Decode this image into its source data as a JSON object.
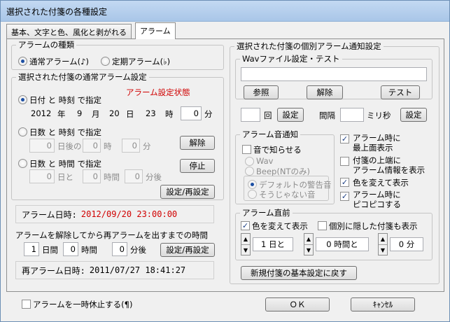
{
  "window": {
    "title": "選択された付箋の各種設定"
  },
  "tabs": [
    {
      "label": "基本、文字と色、風化と剥がれる"
    },
    {
      "label": "アラーム"
    }
  ],
  "alarm_kind": {
    "legend": "アラームの種類",
    "options": [
      {
        "label": "通常アラーム(♪)",
        "selected": true
      },
      {
        "label": "定期アラーム(♭)",
        "selected": false
      }
    ]
  },
  "normal_alarm": {
    "legend": "選択された付箋の通常アラーム設定",
    "status_label": "アラーム設定状態",
    "date_time": {
      "label": "日付 と 時刻 で指定",
      "selected": true,
      "year": "2012",
      "year_unit": "年",
      "month": "9",
      "month_unit": "月",
      "day": "20",
      "day_unit": "日",
      "hour": "23",
      "hour_unit": "時",
      "minute": "0",
      "minute_unit": "分"
    },
    "days_time": {
      "label": "日数 と 時刻 で指定",
      "selected": false,
      "days": "0",
      "days_unit": "日後の",
      "hour": "0",
      "hour_unit": "時",
      "minute": "0",
      "minute_unit": "分",
      "clear_button": "解除"
    },
    "days_duration": {
      "label": "日数 と 時間 で指定",
      "selected": false,
      "days": "0",
      "days_unit": "日と",
      "hours": "0",
      "hours_unit": "時間",
      "minutes": "0",
      "minutes_unit": "分後",
      "stop_button": "停止"
    },
    "set_button": "設定/再設定"
  },
  "alarm_datetime": {
    "label": "アラーム日時:",
    "value": "2012/09/20 23:00:00"
  },
  "realarm": {
    "heading": "アラームを解除してから再アラームを出すまでの時間",
    "days": "1",
    "days_unit": "日間",
    "hours": "0",
    "hours_unit": "時間",
    "minutes": "0",
    "minutes_unit": "分後",
    "set_button": "設定/再設定",
    "datetime_label": "再アラーム日時:",
    "datetime_value": "2011/07/27 18:41:27"
  },
  "individual": {
    "legend": "選択された付箋の個別アラーム通知設定",
    "wav": {
      "legend": "Wavファイル設定・テスト",
      "path": "",
      "browse_button": "参照",
      "clear_button": "解除",
      "test_button": "テスト",
      "count": "",
      "count_unit": "回",
      "count_set_button": "設定",
      "interval_label": "間隔",
      "interval": "",
      "interval_unit": "ミリ秒",
      "interval_set_button": "設定"
    }
  },
  "sound_notify": {
    "legend": "アラーム音通知",
    "enable_label": "音で知らせる",
    "enabled": false,
    "options": [
      {
        "label": "Wav"
      },
      {
        "label": "Beep(NTのみ)"
      }
    ],
    "sub_options": [
      {
        "label": "デフォルトの警告音",
        "selected": true
      },
      {
        "label": "そうじゃない音",
        "selected": false
      }
    ]
  },
  "right_checks": [
    {
      "label": "アラーム時に\n最上面表示",
      "checked": true
    },
    {
      "label": "付箋の上端に\nアラーム情報を表示",
      "checked": false
    },
    {
      "label": "色を変えて表示",
      "checked": true
    },
    {
      "label": "アラーム時に\nピコピコする",
      "checked": true
    }
  ],
  "before_alarm": {
    "legend": "アラーム直前",
    "color_label": "色を変えて表示",
    "color_checked": true,
    "hidden_label": "個別に隠した付箋も表示",
    "hidden_checked": false,
    "days": "1 日と",
    "hours": "0 時間と",
    "minutes": "0 分"
  },
  "reset_button": "新規付箋の基本設定に戻す",
  "pause": {
    "label": "アラームを一時休止する(¶)",
    "checked": false
  },
  "ok_button": "ＯＫ",
  "cancel_button": "ｷｬﾝｾﾙ"
}
